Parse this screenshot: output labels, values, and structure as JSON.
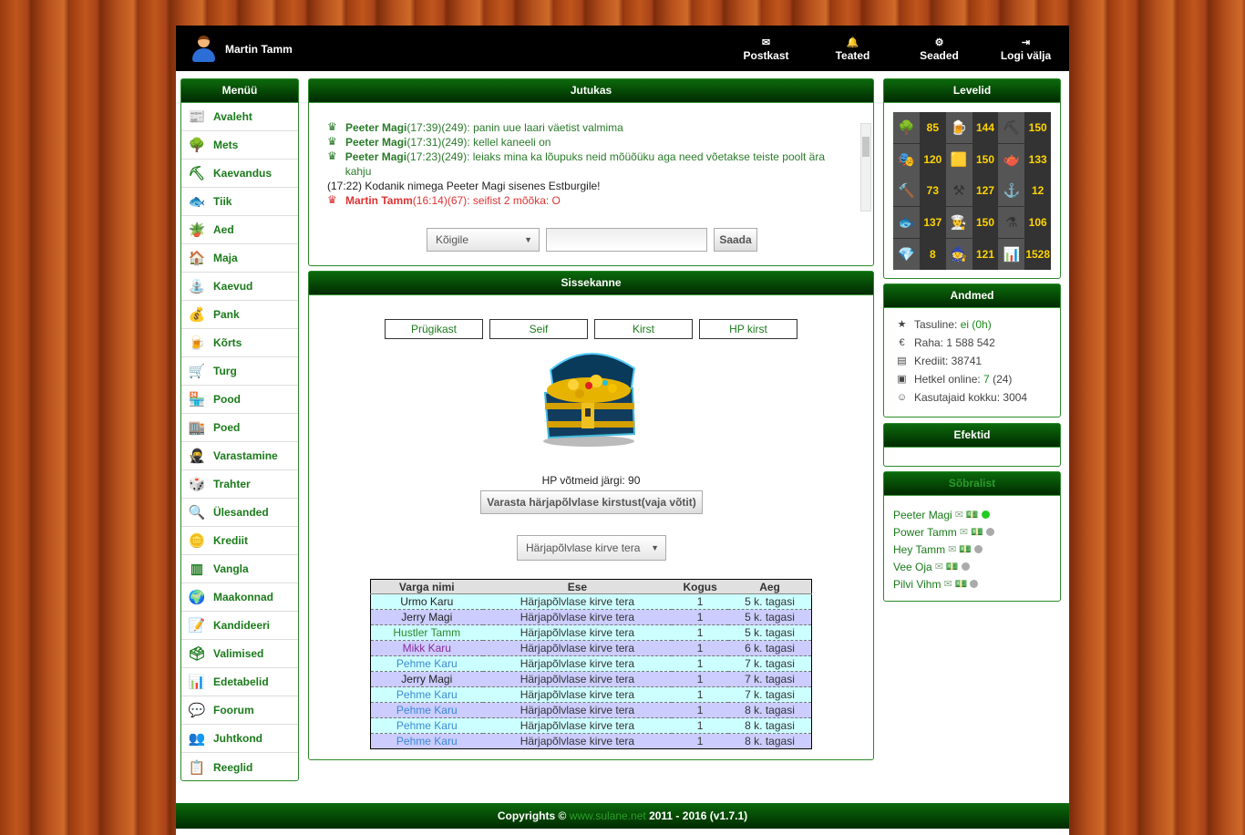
{
  "user": {
    "name": "Martin Tamm"
  },
  "topnav": [
    {
      "label": "Postkast",
      "icon": "envelope-icon",
      "glyph": "✉"
    },
    {
      "label": "Teated",
      "icon": "bell-icon",
      "glyph": "🔔"
    },
    {
      "label": "Seaded",
      "icon": "gear-icon",
      "glyph": "⚙"
    },
    {
      "label": "Logi välja",
      "icon": "logout-icon",
      "glyph": "⇥"
    }
  ],
  "menu": {
    "title": "Menüü",
    "items": [
      {
        "label": "Avaleht",
        "icon": "newspaper-icon",
        "glyph": "📰"
      },
      {
        "label": "Mets",
        "icon": "tree-icon",
        "glyph": "🌳"
      },
      {
        "label": "Kaevandus",
        "icon": "pickaxe-icon",
        "glyph": "⛏"
      },
      {
        "label": "Tiik",
        "icon": "fish-icon",
        "glyph": "🐟"
      },
      {
        "label": "Aed",
        "icon": "watering-can-icon",
        "glyph": "🪴"
      },
      {
        "label": "Maja",
        "icon": "house-icon",
        "glyph": "🏠"
      },
      {
        "label": "Kaevud",
        "icon": "well-icon",
        "glyph": "⛲"
      },
      {
        "label": "Pank",
        "icon": "money-icon",
        "glyph": "💰"
      },
      {
        "label": "Kõrts",
        "icon": "beer-icon",
        "glyph": "🍺"
      },
      {
        "label": "Turg",
        "icon": "market-icon",
        "glyph": "🛒"
      },
      {
        "label": "Pood",
        "icon": "shop-icon",
        "glyph": "🏪"
      },
      {
        "label": "Poed",
        "icon": "shops-icon",
        "glyph": "🏬"
      },
      {
        "label": "Varastamine",
        "icon": "thief-icon",
        "glyph": "🥷"
      },
      {
        "label": "Trahter",
        "icon": "dice-icon",
        "glyph": "🎲"
      },
      {
        "label": "Ülesanded",
        "icon": "magnifier-icon",
        "glyph": "🔍"
      },
      {
        "label": "Krediit",
        "icon": "coins-icon",
        "glyph": "🪙"
      },
      {
        "label": "Vangla",
        "icon": "jail-icon",
        "glyph": "▥"
      },
      {
        "label": "Maakonnad",
        "icon": "globe-icon",
        "glyph": "🌍"
      },
      {
        "label": "Kandideeri",
        "icon": "document-add-icon",
        "glyph": "📝"
      },
      {
        "label": "Valimised",
        "icon": "ballot-box-icon",
        "glyph": "🗳"
      },
      {
        "label": "Edetabelid",
        "icon": "bar-chart-icon",
        "glyph": "📊"
      },
      {
        "label": "Foorum",
        "icon": "speech-bubble-icon",
        "glyph": "💬"
      },
      {
        "label": "Juhtkond",
        "icon": "people-icon",
        "glyph": "👥"
      },
      {
        "label": "Reeglid",
        "icon": "clipboard-icon",
        "glyph": "📋"
      }
    ]
  },
  "chat": {
    "title": "Jutukas",
    "lines": [
      {
        "name": "Peeter Magi",
        "meta": "(17:39)(249): ",
        "text": "panin uue laari väetist valmima",
        "type": "user"
      },
      {
        "name": "Peeter Magi",
        "meta": "(17:31)(249): ",
        "text": "kellel kaneeli on",
        "type": "user"
      },
      {
        "name": "Peeter Magi",
        "meta": "(17:23)(249): ",
        "text": "leiaks mina ka lõupuks neid mõüõüku aga need võetakse teiste poolt ära kahju",
        "type": "user"
      },
      {
        "name": "",
        "meta": "(17:22) ",
        "text": "Kodanik nimega Peeter Magi sisenes Estburgile!",
        "type": "sys"
      },
      {
        "name": "Martin Tamm",
        "meta": "(16:14)(67): ",
        "text": "seifist 2 mõõka: O",
        "type": "me"
      }
    ],
    "recipient": "Kõigile",
    "send_label": "Saada"
  },
  "entry": {
    "title": "Sissekanne",
    "tabs": [
      "Prügikast",
      "Seif",
      "Kirst",
      "HP kirst"
    ],
    "hp_keys": "HP võtmeid järgi: 90",
    "steal_label": "Varasta härjapõlvlase kirstust(vaja võtit)",
    "item_select": "Härjapõlvlase kirve tera",
    "table": {
      "headers": [
        "Varga nimi",
        "Ese",
        "Kogus",
        "Aeg"
      ],
      "rows": [
        {
          "name": "Urmo Karu",
          "item": "Härjapõlvlase kirve tera",
          "qty": "1",
          "time": "5 k. tagasi",
          "color": "#222"
        },
        {
          "name": "Jerry Magi",
          "item": "Härjapõlvlase kirve tera",
          "qty": "1",
          "time": "5 k. tagasi",
          "color": "#222"
        },
        {
          "name": "Hustler Tamm",
          "item": "Härjapõlvlase kirve tera",
          "qty": "1",
          "time": "5 k. tagasi",
          "color": "#2a8a2a"
        },
        {
          "name": "Mikk Karu",
          "item": "Härjapõlvlase kirve tera",
          "qty": "1",
          "time": "6 k. tagasi",
          "color": "#8a2a9a"
        },
        {
          "name": "Pehme Karu",
          "item": "Härjapõlvlase kirve tera",
          "qty": "1",
          "time": "7 k. tagasi",
          "color": "#3a8ad6"
        },
        {
          "name": "Jerry Magi",
          "item": "Härjapõlvlase kirve tera",
          "qty": "1",
          "time": "7 k. tagasi",
          "color": "#222"
        },
        {
          "name": "Pehme Karu",
          "item": "Härjapõlvlase kirve tera",
          "qty": "1",
          "time": "7 k. tagasi",
          "color": "#3a8ad6"
        },
        {
          "name": "Pehme Karu",
          "item": "Härjapõlvlase kirve tera",
          "qty": "1",
          "time": "8 k. tagasi",
          "color": "#3a8ad6"
        },
        {
          "name": "Pehme Karu",
          "item": "Härjapõlvlase kirve tera",
          "qty": "1",
          "time": "8 k. tagasi",
          "color": "#3a8ad6"
        },
        {
          "name": "Pehme Karu",
          "item": "Härjapõlvlase kirve tera",
          "qty": "1",
          "time": "8 k. tagasi",
          "color": "#3a8ad6"
        }
      ]
    }
  },
  "levels": {
    "title": "Levelid",
    "cells": [
      {
        "icon": "tree-icon",
        "glyph": "🌳",
        "value": "85"
      },
      {
        "icon": "beer-icon",
        "glyph": "🍺",
        "value": "144"
      },
      {
        "icon": "pickaxe-icon",
        "glyph": "⛏",
        "value": "150"
      },
      {
        "icon": "mask-icon",
        "glyph": "🎭",
        "value": "120"
      },
      {
        "icon": "gold-bar-icon",
        "glyph": "🟨",
        "value": "150"
      },
      {
        "icon": "watering-can-icon",
        "glyph": "🫖",
        "value": "133"
      },
      {
        "icon": "hammer-icon",
        "glyph": "🔨",
        "value": "73"
      },
      {
        "icon": "crossed-tools-icon",
        "glyph": "⚒",
        "value": "127"
      },
      {
        "icon": "anvil-icon",
        "glyph": "⚓",
        "value": "12"
      },
      {
        "icon": "fish-icon",
        "glyph": "🐟",
        "value": "137"
      },
      {
        "icon": "chef-hat-icon",
        "glyph": "👨‍🍳",
        "value": "150"
      },
      {
        "icon": "flask-icon",
        "glyph": "⚗",
        "value": "106"
      },
      {
        "icon": "diamond-icon",
        "glyph": "💎",
        "value": "8"
      },
      {
        "icon": "witch-hat-icon",
        "glyph": "🧙",
        "value": "121"
      },
      {
        "icon": "bar-chart-icon",
        "glyph": "📊",
        "value": "1528"
      }
    ]
  },
  "andmed": {
    "title": "Andmed",
    "rows": [
      {
        "label": "Tasuline: ",
        "value": "ei (0h)",
        "extra": "",
        "icon": "star-badge-icon",
        "glyph": "★"
      },
      {
        "label": "Raha: 1 588 542",
        "value": "",
        "extra": "",
        "icon": "euro-icon",
        "glyph": "€"
      },
      {
        "label": "Krediit: 38741",
        "value": "",
        "extra": "",
        "icon": "coins-icon",
        "glyph": "▤"
      },
      {
        "label": "Hetkel online: ",
        "value": "7",
        "extra": " (24)",
        "icon": "monitor-icon",
        "glyph": "▣"
      },
      {
        "label": "Kasutajaid kokku: 3004",
        "value": "",
        "extra": "",
        "icon": "users-icon",
        "glyph": "☺"
      }
    ]
  },
  "efektid": {
    "title": "Efektid"
  },
  "friends": {
    "title": "Sõbralist",
    "items": [
      {
        "name": "Peeter Magi",
        "online": true
      },
      {
        "name": "Power Tamm",
        "online": false
      },
      {
        "name": "Hey Tamm",
        "online": false
      },
      {
        "name": "Vee Oja",
        "online": false
      },
      {
        "name": "Pilvi Vihm",
        "online": false
      }
    ]
  },
  "footer": {
    "prefix": "Copyrights © ",
    "site": "www.sulane.net",
    "suffix": " 2011 - 2016 (v1.7.1)"
  }
}
